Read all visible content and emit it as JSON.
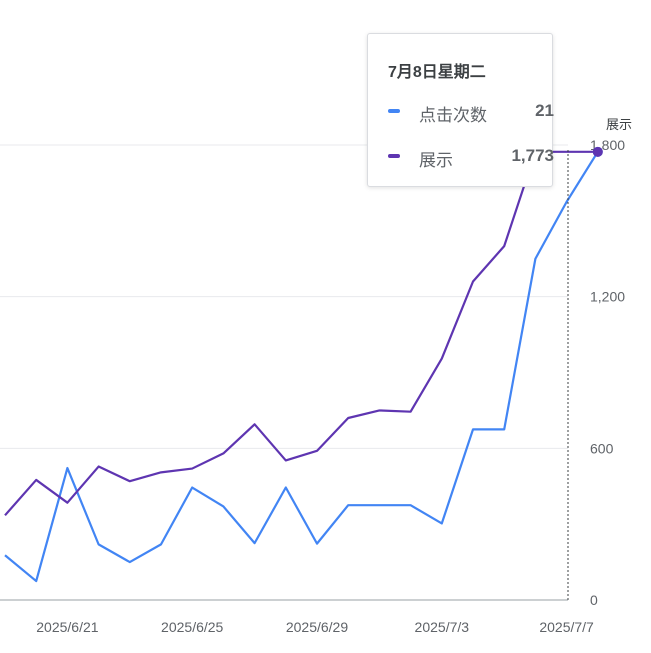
{
  "chart_data": {
    "type": "line",
    "x": [
      "2025/6/19",
      "2025/6/20",
      "2025/6/21",
      "2025/6/22",
      "2025/6/23",
      "2025/6/24",
      "2025/6/25",
      "2025/6/26",
      "2025/6/27",
      "2025/6/28",
      "2025/6/29",
      "2025/6/30",
      "2025/7/1",
      "2025/7/2",
      "2025/7/3",
      "2025/7/4",
      "2025/7/5",
      "2025/7/6",
      "2025/7/7",
      "2025/7/8"
    ],
    "series": [
      {
        "name": "点击次数",
        "color": "#4285f4",
        "values": [
          177,
          75,
          522,
          220,
          150,
          220,
          445,
          370,
          225,
          445,
          223,
          375,
          375,
          375,
          303,
          675,
          675,
          1350,
          1575,
          1773
        ]
      },
      {
        "name": "展示",
        "color": "#5e35b1",
        "values": [
          335,
          475,
          385,
          528,
          470,
          505,
          520,
          580,
          695,
          552,
          590,
          720,
          750,
          745,
          955,
          1260,
          1400,
          1773,
          1773,
          1773
        ]
      }
    ],
    "yaxis_right": {
      "title": "展示",
      "ticks": [
        "0",
        "600",
        "1,200",
        "1,800"
      ],
      "ylim": [
        0,
        1800
      ]
    },
    "xticks": [
      "2025/6/21",
      "2025/6/25",
      "2025/6/29",
      "2025/7/3",
      "2025/7/7"
    ],
    "grid": true,
    "tooltip": {
      "title": "7月8日星期二",
      "rows": [
        {
          "label": "点击次数",
          "value": "21",
          "color": "#4285f4"
        },
        {
          "label": "展示",
          "value": "1,773",
          "color": "#5e35b1"
        }
      ]
    }
  }
}
